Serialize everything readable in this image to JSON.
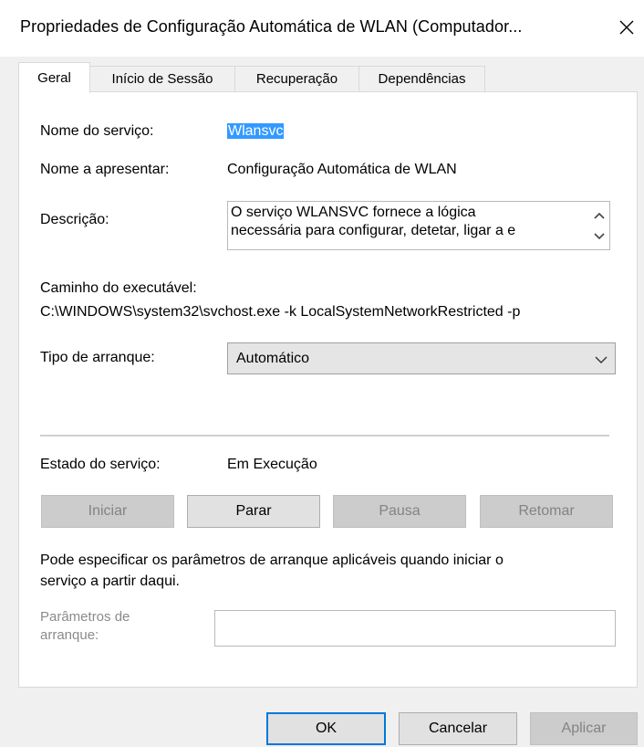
{
  "window": {
    "title": "Propriedades de Configuração Automática de WLAN (Computador...",
    "close_icon": "close-icon"
  },
  "tabs": [
    {
      "label": "Geral",
      "active": true
    },
    {
      "label": "Início de Sessão",
      "active": false
    },
    {
      "label": "Recuperação",
      "active": false
    },
    {
      "label": "Dependências",
      "active": false
    }
  ],
  "general": {
    "service_name_label": "Nome do serviço:",
    "service_name_value": "Wlansvc",
    "display_name_label": "Nome a apresentar:",
    "display_name_value": "Configuração Automática de WLAN",
    "description_label": "Descrição:",
    "description_value": "O serviço WLANSVC fornece a lógica\nnecessária para configurar, detetar, ligar a e",
    "exe_path_label": "Caminho do executável:",
    "exe_path_value": "C:\\WINDOWS\\system32\\svchost.exe -k LocalSystemNetworkRestricted -p",
    "startup_type_label": "Tipo de arranque:",
    "startup_type_value": "Automático",
    "service_status_label": "Estado do serviço:",
    "service_status_value": "Em Execução"
  },
  "service_buttons": {
    "start": "Iniciar",
    "stop": "Parar",
    "pause": "Pausa",
    "resume": "Retomar"
  },
  "start_params": {
    "hint": "Pode especificar os parâmetros de arranque aplicáveis quando iniciar o\nserviço a partir daqui.",
    "label": "Parâmetros de\narranque:",
    "value": ""
  },
  "dialog_buttons": {
    "ok": "OK",
    "cancel": "Cancelar",
    "apply": "Aplicar"
  },
  "colors": {
    "selection": "#3399ff",
    "focus_border": "#0078d7",
    "dialog_bg": "#f0f0f0"
  }
}
